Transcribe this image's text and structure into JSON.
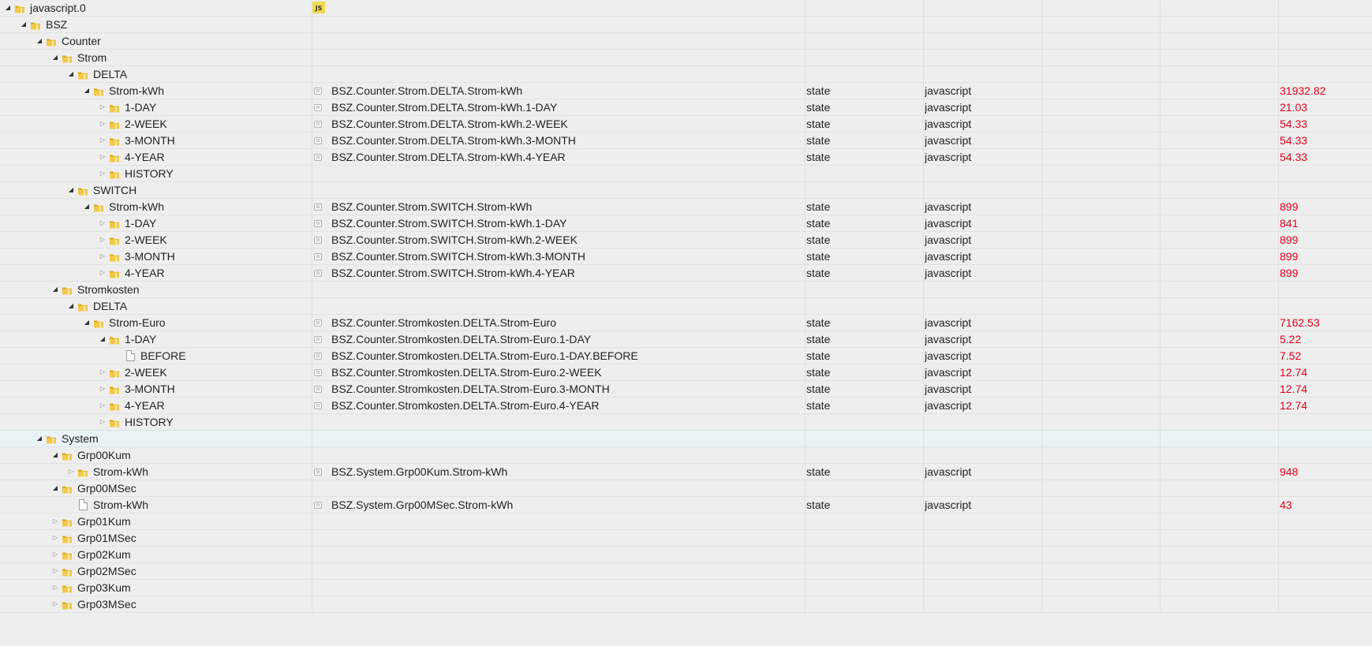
{
  "rows": [
    {
      "name": "javascript.0",
      "level": 0,
      "icon": "folder",
      "expander": "expanded",
      "badge": "JS"
    },
    {
      "name": "BSZ",
      "level": 1,
      "icon": "folder",
      "expander": "expanded"
    },
    {
      "name": "Counter",
      "level": 2,
      "icon": "folder",
      "expander": "expanded"
    },
    {
      "name": "Strom",
      "level": 3,
      "icon": "folder",
      "expander": "expanded"
    },
    {
      "name": "DELTA",
      "level": 4,
      "icon": "folder",
      "expander": "expanded"
    },
    {
      "name": "Strom-kWh",
      "level": 5,
      "icon": "folder",
      "expander": "expanded",
      "id": "BSZ.Counter.Strom.DELTA.Strom-kWh",
      "type": "state",
      "role": "javascript",
      "value": "31932.82"
    },
    {
      "name": "1-DAY",
      "level": 6,
      "icon": "folder",
      "expander": "collapsed",
      "id": "BSZ.Counter.Strom.DELTA.Strom-kWh.1-DAY",
      "type": "state",
      "role": "javascript",
      "value": "21.03"
    },
    {
      "name": "2-WEEK",
      "level": 6,
      "icon": "folder",
      "expander": "collapsed",
      "id": "BSZ.Counter.Strom.DELTA.Strom-kWh.2-WEEK",
      "type": "state",
      "role": "javascript",
      "value": "54.33"
    },
    {
      "name": "3-MONTH",
      "level": 6,
      "icon": "folder",
      "expander": "collapsed",
      "id": "BSZ.Counter.Strom.DELTA.Strom-kWh.3-MONTH",
      "type": "state",
      "role": "javascript",
      "value": "54.33"
    },
    {
      "name": "4-YEAR",
      "level": 6,
      "icon": "folder",
      "expander": "collapsed",
      "id": "BSZ.Counter.Strom.DELTA.Strom-kWh.4-YEAR",
      "type": "state",
      "role": "javascript",
      "value": "54.33"
    },
    {
      "name": "HISTORY",
      "level": 6,
      "icon": "folder",
      "expander": "collapsed"
    },
    {
      "name": "SWITCH",
      "level": 4,
      "icon": "folder",
      "expander": "expanded"
    },
    {
      "name": "Strom-kWh",
      "level": 5,
      "icon": "folder",
      "expander": "expanded",
      "id": "BSZ.Counter.Strom.SWITCH.Strom-kWh",
      "type": "state",
      "role": "javascript",
      "value": "899"
    },
    {
      "name": "1-DAY",
      "level": 6,
      "icon": "folder",
      "expander": "collapsed",
      "id": "BSZ.Counter.Strom.SWITCH.Strom-kWh.1-DAY",
      "type": "state",
      "role": "javascript",
      "value": "841"
    },
    {
      "name": "2-WEEK",
      "level": 6,
      "icon": "folder",
      "expander": "collapsed",
      "id": "BSZ.Counter.Strom.SWITCH.Strom-kWh.2-WEEK",
      "type": "state",
      "role": "javascript",
      "value": "899"
    },
    {
      "name": "3-MONTH",
      "level": 6,
      "icon": "folder",
      "expander": "collapsed",
      "id": "BSZ.Counter.Strom.SWITCH.Strom-kWh.3-MONTH",
      "type": "state",
      "role": "javascript",
      "value": "899"
    },
    {
      "name": "4-YEAR",
      "level": 6,
      "icon": "folder",
      "expander": "collapsed",
      "id": "BSZ.Counter.Strom.SWITCH.Strom-kWh.4-YEAR",
      "type": "state",
      "role": "javascript",
      "value": "899"
    },
    {
      "name": "Stromkosten",
      "level": 3,
      "icon": "folder",
      "expander": "expanded"
    },
    {
      "name": "DELTA",
      "level": 4,
      "icon": "folder",
      "expander": "expanded"
    },
    {
      "name": "Strom-Euro",
      "level": 5,
      "icon": "folder",
      "expander": "expanded",
      "id": "BSZ.Counter.Stromkosten.DELTA.Strom-Euro",
      "type": "state",
      "role": "javascript",
      "value": "7162.53"
    },
    {
      "name": "1-DAY",
      "level": 6,
      "icon": "folder",
      "expander": "expanded",
      "id": "BSZ.Counter.Stromkosten.DELTA.Strom-Euro.1-DAY",
      "type": "state",
      "role": "javascript",
      "value": "5.22"
    },
    {
      "name": "BEFORE",
      "level": 7,
      "icon": "file",
      "expander": "none",
      "id": "BSZ.Counter.Stromkosten.DELTA.Strom-Euro.1-DAY.BEFORE",
      "type": "state",
      "role": "javascript",
      "value": "7.52"
    },
    {
      "name": "2-WEEK",
      "level": 6,
      "icon": "folder",
      "expander": "collapsed",
      "id": "BSZ.Counter.Stromkosten.DELTA.Strom-Euro.2-WEEK",
      "type": "state",
      "role": "javascript",
      "value": "12.74"
    },
    {
      "name": "3-MONTH",
      "level": 6,
      "icon": "folder",
      "expander": "collapsed",
      "id": "BSZ.Counter.Stromkosten.DELTA.Strom-Euro.3-MONTH",
      "type": "state",
      "role": "javascript",
      "value": "12.74"
    },
    {
      "name": "4-YEAR",
      "level": 6,
      "icon": "folder",
      "expander": "collapsed",
      "id": "BSZ.Counter.Stromkosten.DELTA.Strom-Euro.4-YEAR",
      "type": "state",
      "role": "javascript",
      "value": "12.74"
    },
    {
      "name": "HISTORY",
      "level": 6,
      "icon": "folder",
      "expander": "collapsed"
    },
    {
      "name": "System",
      "level": 2,
      "icon": "folder",
      "expander": "expanded",
      "selected": true
    },
    {
      "name": "Grp00Kum",
      "level": 3,
      "icon": "folder",
      "expander": "expanded"
    },
    {
      "name": "Strom-kWh",
      "level": 4,
      "icon": "folder",
      "expander": "collapsed",
      "id": "BSZ.System.Grp00Kum.Strom-kWh",
      "type": "state",
      "role": "javascript",
      "value": "948"
    },
    {
      "name": "Grp00MSec",
      "level": 3,
      "icon": "folder",
      "expander": "expanded"
    },
    {
      "name": "Strom-kWh",
      "level": 4,
      "icon": "file",
      "expander": "none",
      "id": "BSZ.System.Grp00MSec.Strom-kWh",
      "type": "state",
      "role": "javascript",
      "value": "43"
    },
    {
      "name": "Grp01Kum",
      "level": 3,
      "icon": "folder",
      "expander": "collapsed"
    },
    {
      "name": "Grp01MSec",
      "level": 3,
      "icon": "folder",
      "expander": "collapsed"
    },
    {
      "name": "Grp02Kum",
      "level": 3,
      "icon": "folder",
      "expander": "collapsed"
    },
    {
      "name": "Grp02MSec",
      "level": 3,
      "icon": "folder",
      "expander": "collapsed"
    },
    {
      "name": "Grp03Kum",
      "level": 3,
      "icon": "folder",
      "expander": "collapsed"
    },
    {
      "name": "Grp03MSec",
      "level": 3,
      "icon": "folder",
      "expander": "collapsed"
    }
  ],
  "icons": {
    "expanded": "◢",
    "collapsed": "▷",
    "folder": "folder-icon",
    "file": "file-icon",
    "state": "state-id-icon"
  },
  "colors": {
    "value": "#e3001b",
    "selected_row": "#e9f2f6",
    "background": "#eeeeee"
  }
}
